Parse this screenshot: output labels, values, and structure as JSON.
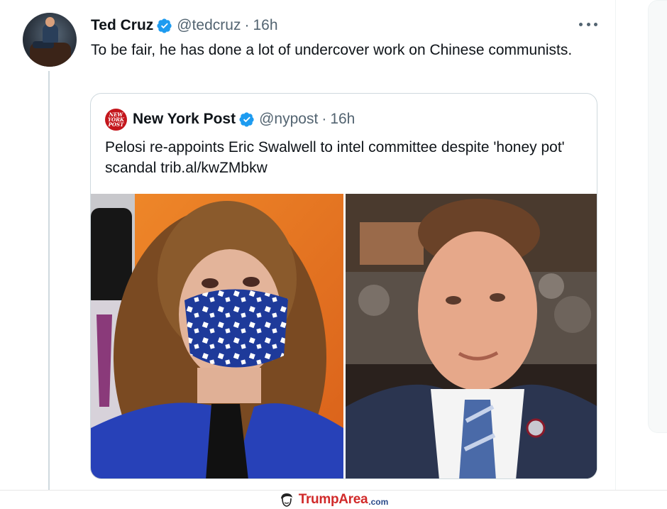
{
  "tweet": {
    "author_name": "Ted Cruz",
    "author_handle": "@tedcruz",
    "separator": "·",
    "time": "16h",
    "text": "To be fair, he has done a lot of undercover work on Chinese communists."
  },
  "quoted_tweet": {
    "author_name": "New York Post",
    "author_handle": "@nypost",
    "separator": "·",
    "time": "16h",
    "logo_text_1": "NEW",
    "logo_text_2": "YORK",
    "logo_text_3": "POST",
    "text": "Pelosi re-appoints Eric Swalwell to intel committee despite 'honey pot' scandal trib.al/kwZMbkw"
  },
  "icons": {
    "verified": "verified-badge-icon",
    "more": "more-options-icon",
    "brand": "trump-head-icon"
  },
  "colors": {
    "verified_blue": "#1d9bf0",
    "nyp_red": "#c4161c",
    "muted_text": "#536471",
    "brand_red": "#d12a2a"
  },
  "watermark": {
    "name": "TrumpArea",
    "tld": ".com"
  }
}
